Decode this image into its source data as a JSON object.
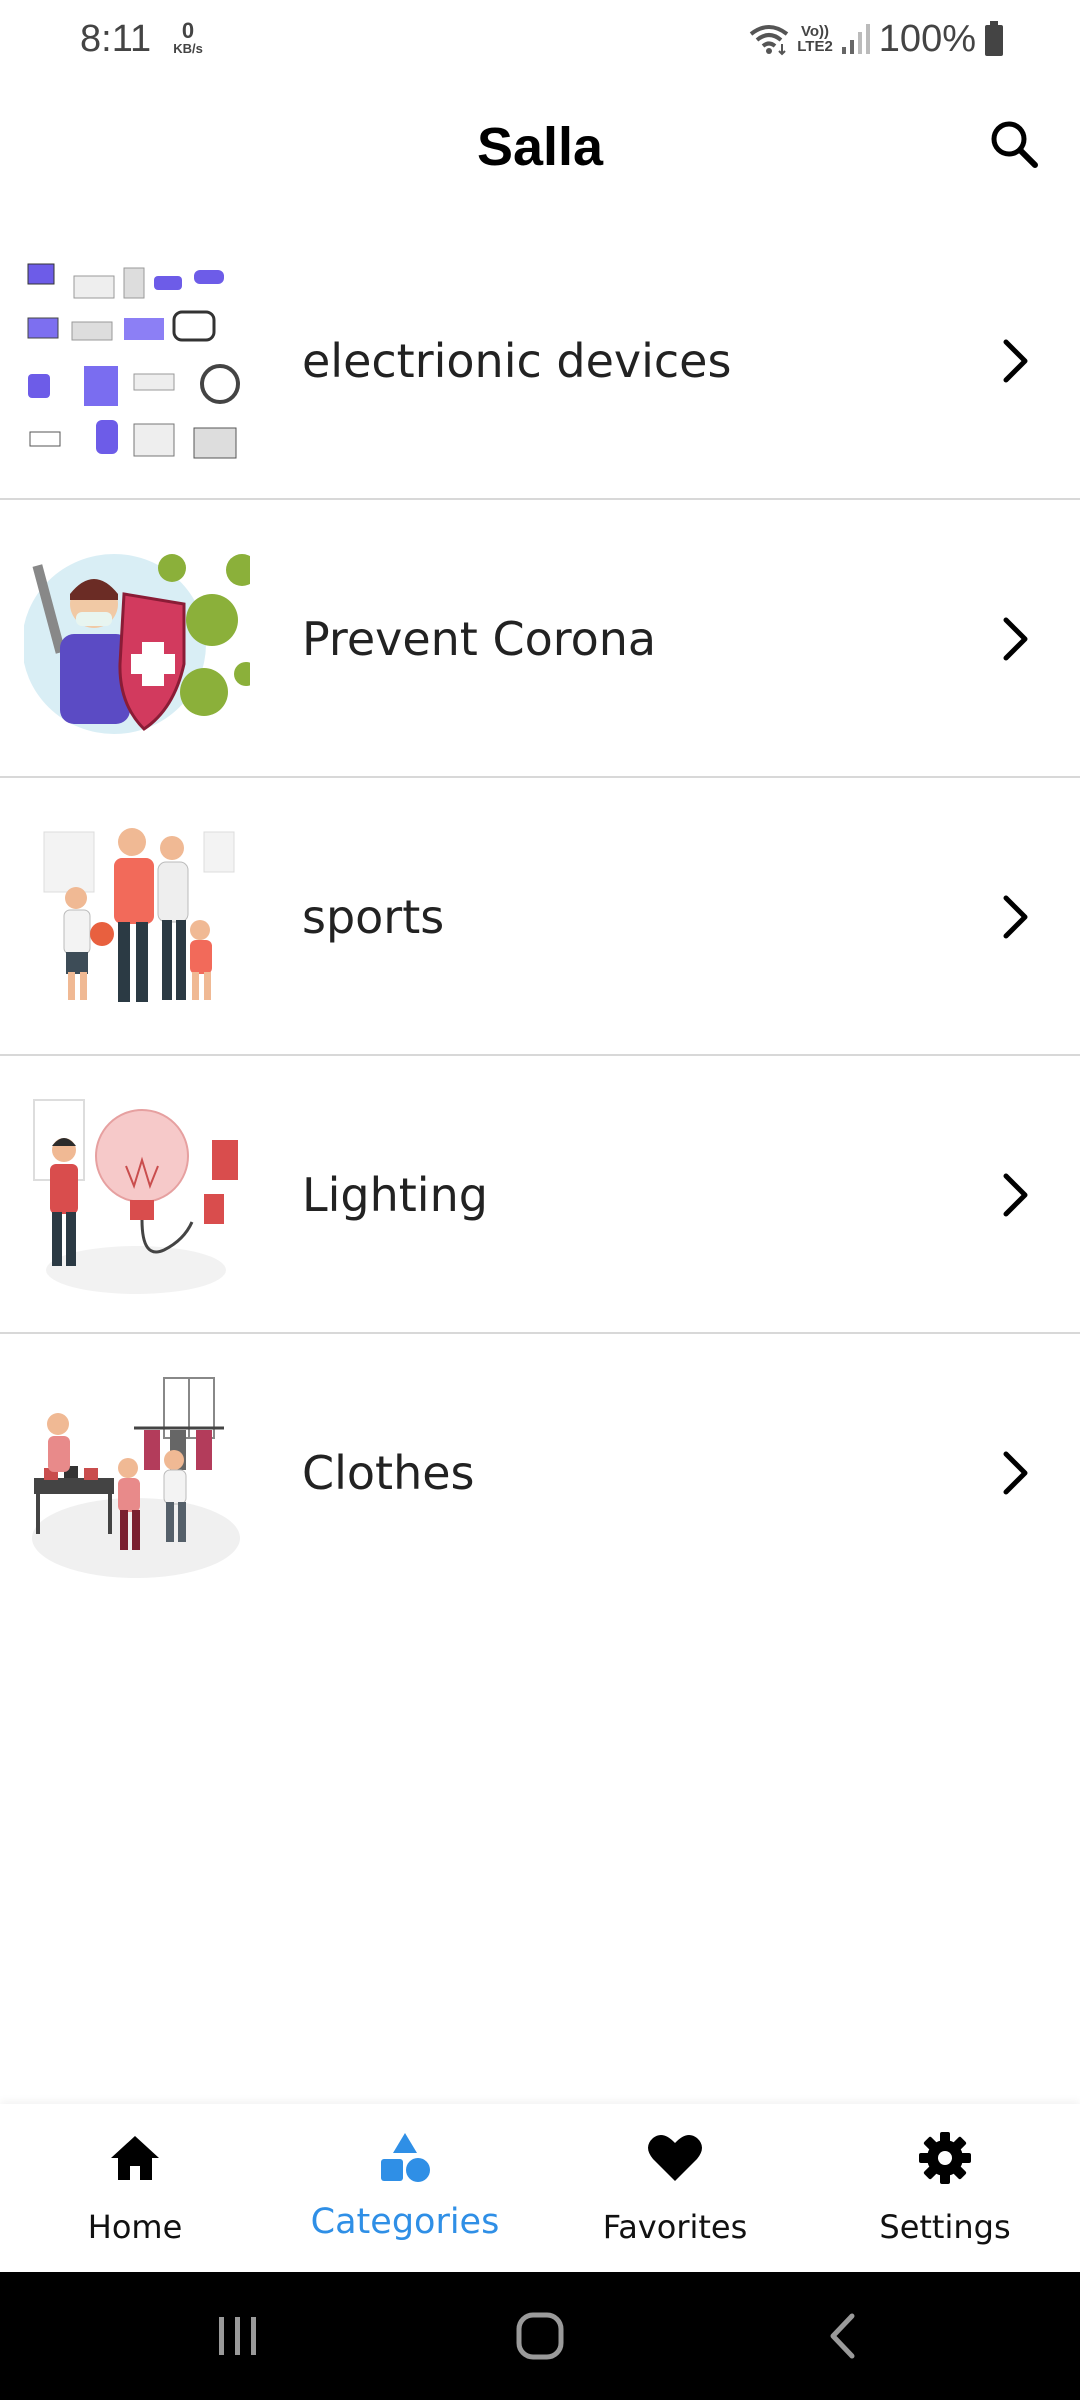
{
  "status_bar": {
    "time": "8:11",
    "net_speed_value": "0",
    "net_speed_unit": "KB/s",
    "volte_label": "Vo))",
    "lte_label": "LTE2",
    "battery": "100%"
  },
  "header": {
    "title": "Salla",
    "search_icon": "search-icon"
  },
  "categories": [
    {
      "label": "electrionic devices",
      "thumb": "electronics-illustration"
    },
    {
      "label": "Prevent Corona",
      "thumb": "corona-illustration"
    },
    {
      "label": "sports",
      "thumb": "sports-family-illustration"
    },
    {
      "label": "Lighting",
      "thumb": "lightbulb-illustration"
    },
    {
      "label": "Clothes",
      "thumb": "clothes-shop-illustration"
    }
  ],
  "bottom_nav": {
    "items": [
      {
        "label": "Home",
        "icon": "home-icon",
        "active": false
      },
      {
        "label": "Categories",
        "icon": "categories-icon",
        "active": true
      },
      {
        "label": "Favorites",
        "icon": "heart-icon",
        "active": false
      },
      {
        "label": "Settings",
        "icon": "gear-icon",
        "active": false
      }
    ]
  },
  "colors": {
    "accent": "#2f8fe6",
    "divider": "#d8d8d8",
    "system_nav": "#000000"
  }
}
